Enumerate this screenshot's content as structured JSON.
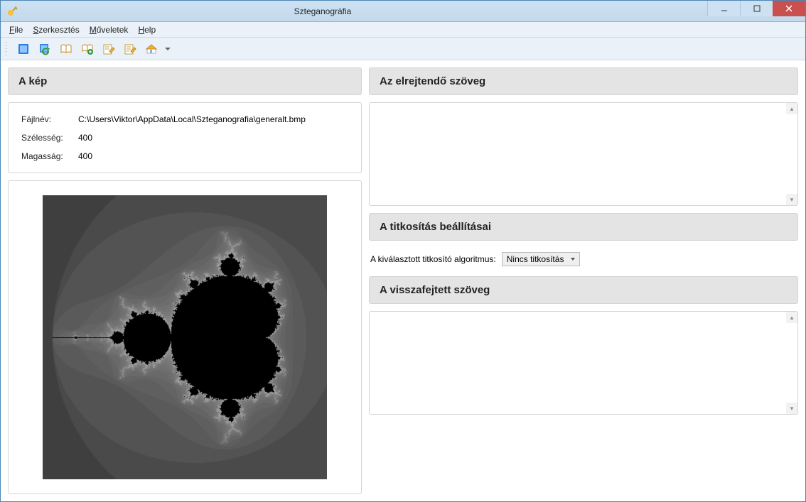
{
  "window": {
    "title": "Szteganográfia"
  },
  "menu": {
    "file": "File",
    "edit": "Szerkesztés",
    "ops": "Műveletek",
    "help": "Help"
  },
  "panels": {
    "image_header": "A kép",
    "hide_text_header": "Az elrejtendő szöveg",
    "crypto_header": "A titkosítás beállításai",
    "decoded_header": "A visszafejtett szöveg"
  },
  "image_meta": {
    "filename_label": "Fájlnév:",
    "filename_value": "C:\\Users\\Viktor\\AppData\\Local\\Szteganografia\\generalt.bmp",
    "width_label": "Szélesség:",
    "width_value": "400",
    "height_label": "Magasság:",
    "height_value": "400"
  },
  "crypto": {
    "algo_label": "A kiválasztott titkosító algoritmus:",
    "algo_selected": "Nincs titkosítás"
  },
  "text": {
    "hide_value": "",
    "decoded_value": ""
  },
  "toolbar_icons": [
    "image",
    "image-plus",
    "book",
    "book-plus",
    "note-edit",
    "note-edit-alt",
    "home"
  ]
}
